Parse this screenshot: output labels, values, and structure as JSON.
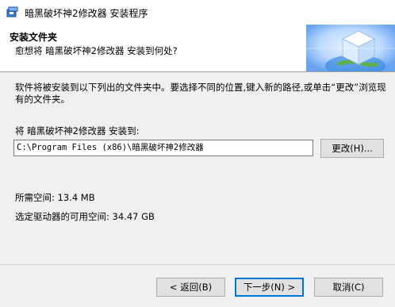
{
  "window": {
    "title": "暗黑破坏神2修改器 安装程序"
  },
  "header": {
    "title": "安装文件夹",
    "subtitle": "愈想将 暗黑破坏神2修改器 安装到何处?"
  },
  "body": {
    "description": "软件将被安装到以下列出的文件夹中。要选择不同的位置,键入新的路径,或单击“更改”浏览现有的文件夹。",
    "destination_label": "将 暗黑破坏神2修改器 安装到:",
    "path_value": "C:\\Program Files (x86)\\暗黑破坏神2修改器",
    "change_button": "更改(H)...",
    "space_required": "所需空间: 13.4 MB",
    "space_available": "选定驱动器的可用空间: 34.47 GB"
  },
  "footer": {
    "back_button": "< 返回(B)",
    "next_button": "下一步(N) >",
    "cancel_button": "取消(C)"
  },
  "colors": {
    "accent": "#0078d7",
    "header_bg": "#ffffff",
    "dialog_bg": "#f0f0f0"
  },
  "icons": {
    "app": "installer-box-icon",
    "header": "globe-cube-icon"
  }
}
